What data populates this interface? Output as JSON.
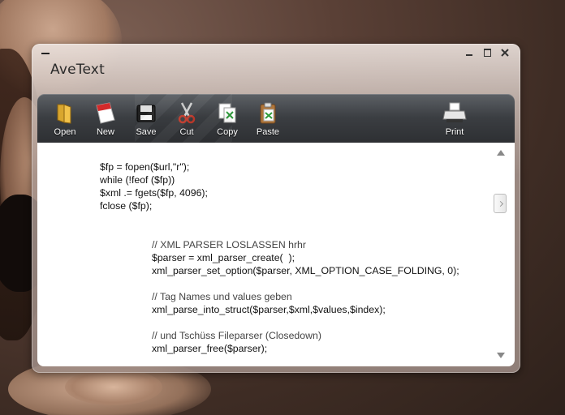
{
  "window": {
    "title": "AveText"
  },
  "toolbar": {
    "open_label": "Open",
    "new_label": "New",
    "save_label": "Save",
    "cut_label": "Cut",
    "copy_label": "Copy",
    "paste_label": "Paste",
    "print_label": "Print"
  },
  "editor": {
    "lines": [
      "$fp = fopen($url,\"r\");",
      "while (!feof ($fp))",
      "$xml .= fgets($fp, 4096);",
      "fclose ($fp);",
      "// XML PARSER LOSLASSEN hrhr",
      "$parser = xml_parser_create(  );",
      "xml_parser_set_option($parser, XML_OPTION_CASE_FOLDING, 0);",
      "// Tag Names und values geben",
      "xml_parse_into_struct($parser,$xml,$values,$index);",
      "// und Tschüss Fileparser (Closedown)",
      "xml_parser_free($parser);"
    ]
  },
  "colors": {
    "toolbar_top": "#5d6166",
    "toolbar_bottom": "#2c2e31",
    "comment": "#444444"
  }
}
